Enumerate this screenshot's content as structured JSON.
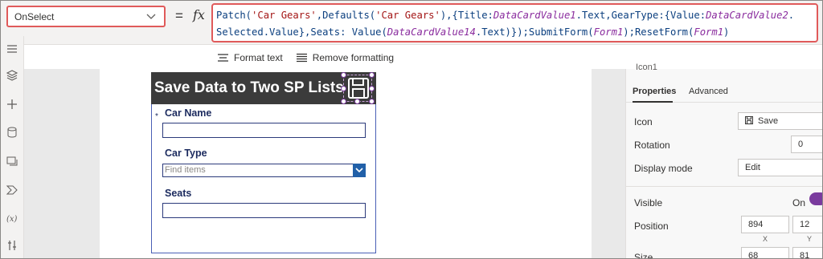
{
  "formula_bar": {
    "property": "OnSelect",
    "equals": "=",
    "fx": "fx",
    "line1": {
      "p1": "Patch(",
      "s1": "'Car Gears'",
      "p2": ",Defaults(",
      "s2": "'Car Gears'",
      "p3": "),{Title:",
      "i1": "DataCardValue1",
      "p4": ".Text,GearType:{Value:",
      "i2": "DataCardValue2",
      "p5": "."
    },
    "line2": {
      "p1": "Selected.Value},Seats: Value(",
      "i1": "DataCardValue14",
      "p2": ".Text)});SubmitForm(",
      "i2": "Form1",
      "p3": ");ResetForm(",
      "i3": "Form1",
      "p4": ")"
    }
  },
  "format_toolbar": {
    "format_text": "Format text",
    "remove_formatting": "Remove formatting"
  },
  "form": {
    "title": "Save Data to Two SP Lists",
    "fields": [
      {
        "label": "Car Name",
        "required_marker": "*"
      },
      {
        "label": "Car Type",
        "placeholder": "Find items"
      },
      {
        "label": "Seats"
      }
    ]
  },
  "properties_panel": {
    "partial_header": "Icon1",
    "tabs": [
      "Properties",
      "Advanced"
    ],
    "icon_label": "Icon",
    "icon_value": "Save",
    "rotation_label": "Rotation",
    "rotation_value": "0",
    "display_mode_label": "Display mode",
    "display_mode_value": "Edit",
    "visible_label": "Visible",
    "visible_value": "On",
    "position_label": "Position",
    "position_x": "894",
    "position_y": "12",
    "x_label": "X",
    "y_label": "Y",
    "size_label": "Size",
    "size_w": "68",
    "size_h": "81"
  },
  "colors": {
    "highlight_border": "#e05a5a",
    "form_header_bg": "#3b3b3b",
    "accent_purple": "#7a3b9e",
    "dropdown_button": "#2160a8"
  },
  "icons": [
    "chevron-down-icon",
    "hamburger-icon",
    "layers-icon",
    "plus-icon",
    "database-icon",
    "media-icon",
    "advanced-tools-icon",
    "variables-icon",
    "tools-icon",
    "save-icon",
    "format-text-icon",
    "remove-formatting-icon"
  ]
}
